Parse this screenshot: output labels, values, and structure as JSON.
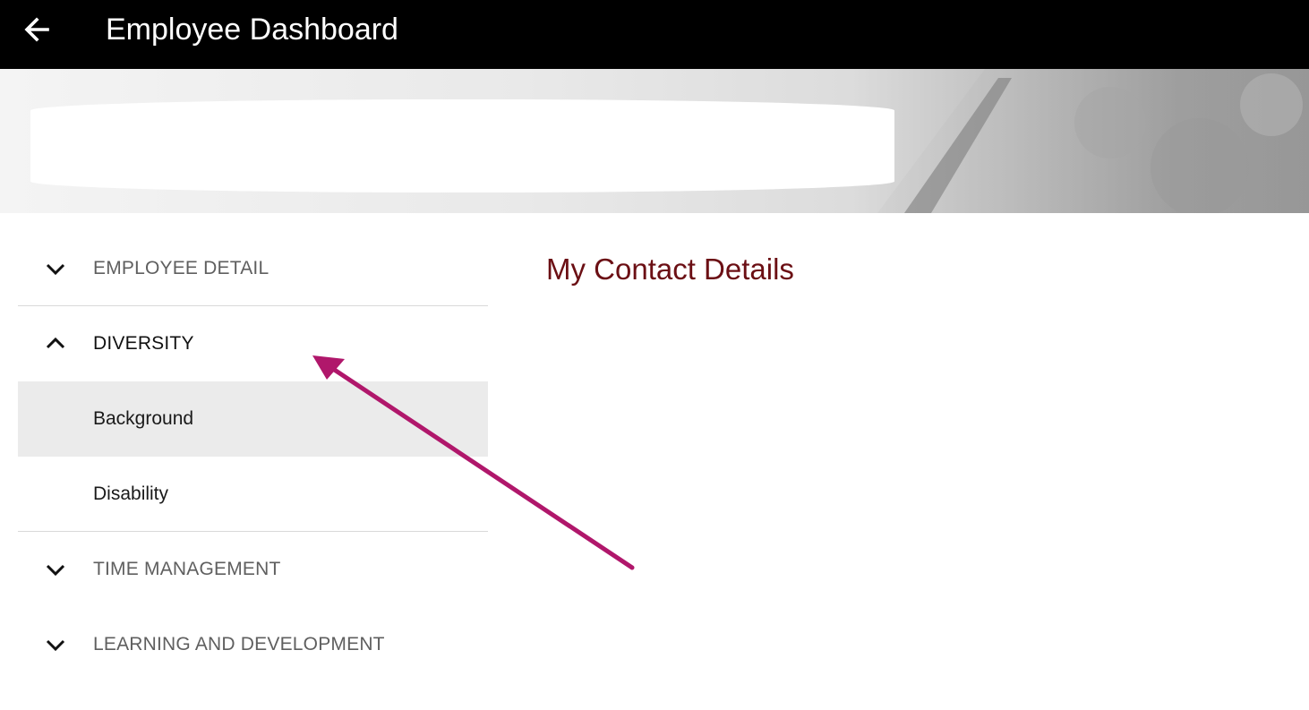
{
  "header": {
    "back_icon": "arrow-left-icon",
    "title": "Employee Dashboard"
  },
  "sidebar": {
    "sections": [
      {
        "label": "EMPLOYEE DETAIL",
        "icon": "chevron-down-icon",
        "expanded": false
      },
      {
        "label": "DIVERSITY",
        "icon": "chevron-up-icon",
        "expanded": true,
        "children": [
          {
            "label": "Background",
            "selected": true
          },
          {
            "label": "Disability",
            "selected": false
          }
        ]
      },
      {
        "label": "TIME MANAGEMENT",
        "icon": "chevron-down-icon",
        "expanded": false
      },
      {
        "label": "LEARNING AND DEVELOPMENT",
        "icon": "chevron-down-icon",
        "expanded": false
      }
    ]
  },
  "main": {
    "title": "My Contact Details"
  },
  "colors": {
    "topbar": "#000000",
    "title_accent": "#6b0f14",
    "selected_bg": "#ebebeb",
    "annotation": "#b0176b"
  }
}
